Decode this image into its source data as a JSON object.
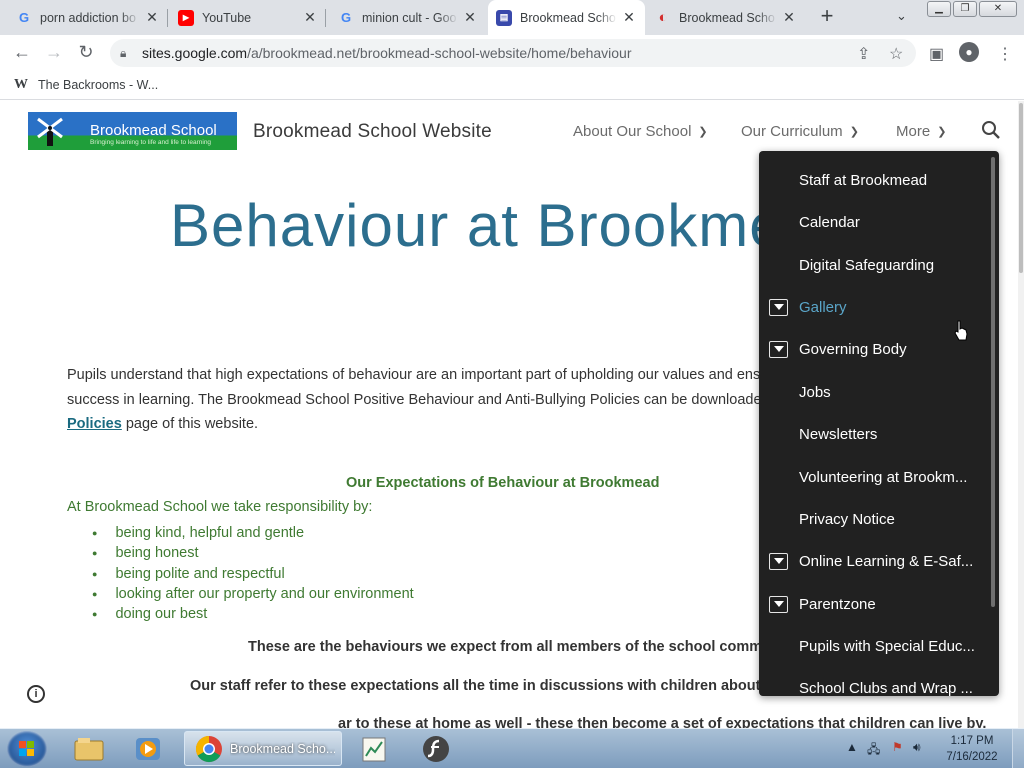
{
  "browser": {
    "tabs": [
      {
        "title": "porn addiction bo",
        "favicon": "google-g-icon"
      },
      {
        "title": "YouTube",
        "favicon": "youtube-icon"
      },
      {
        "title": "minion cult - Goo",
        "favicon": "google-g-icon"
      },
      {
        "title": "Brookmead Scho",
        "favicon": "google-sites-icon",
        "active": true
      },
      {
        "title": "Brookmead Scho",
        "favicon": "brookmead-icon"
      }
    ],
    "new_tab": "+",
    "url_host": "sites.google.com",
    "url_path": "/a/brookmead.net/brookmead-school-website/home/behaviour",
    "bookmark": "The Backrooms - W..."
  },
  "site": {
    "logo_title": "Brookmead School",
    "logo_subtitle": "Bringing learning to life and life to learning",
    "name": "Brookmead School Website",
    "nav": [
      "About Our School",
      "Our Curriculum",
      "More"
    ]
  },
  "content": {
    "heading": "Behaviour at Brookme",
    "para_1": "Pupils understand that high expectations of behaviour are an important part of upholding our values and ensu",
    "para_2": "success in learning.  The Brookmead School Positive Behaviour and Anti-Bullying Policies can be downloaded",
    "para_link": "Policies",
    "para_3": " page of this website.",
    "expectations_heading": "Our Expectations of Behaviour at Brookmead",
    "expectations_intro": "At Brookmead School we take responsibility by:",
    "bullets": [
      "being kind, helpful and gentle",
      "being honest",
      "being polite and respectful",
      "looking after our property and our environment",
      "doing our best"
    ],
    "line_1": "These are the behaviours we expect from all members of the school community.",
    "line_2": "Our staff refer to these expectations all the time in discussions with children about any b",
    "line_3": "ar to these at home as well - these then become a set of expectations that children can live by."
  },
  "menu": {
    "items": [
      {
        "label": "Staff at Brookmead",
        "expandable": false
      },
      {
        "label": "Calendar",
        "expandable": false
      },
      {
        "label": "Digital Safeguarding",
        "expandable": false
      },
      {
        "label": "Gallery",
        "expandable": true,
        "highlighted": true
      },
      {
        "label": "Governing Body",
        "expandable": true
      },
      {
        "label": "Jobs",
        "expandable": false
      },
      {
        "label": "Newsletters",
        "expandable": false
      },
      {
        "label": "Volunteering at Brookm...",
        "expandable": false
      },
      {
        "label": "Privacy Notice",
        "expandable": false
      },
      {
        "label": "Online Learning & E-Saf...",
        "expandable": true
      },
      {
        "label": "Parentzone",
        "expandable": true
      },
      {
        "label": "Pupils with Special Educ...",
        "expandable": false
      },
      {
        "label": "School Clubs and Wrap ...",
        "expandable": false
      }
    ]
  },
  "taskbar": {
    "active_task": "Brookmead Scho...",
    "time": "1:17 PM",
    "date": "7/16/2022"
  }
}
